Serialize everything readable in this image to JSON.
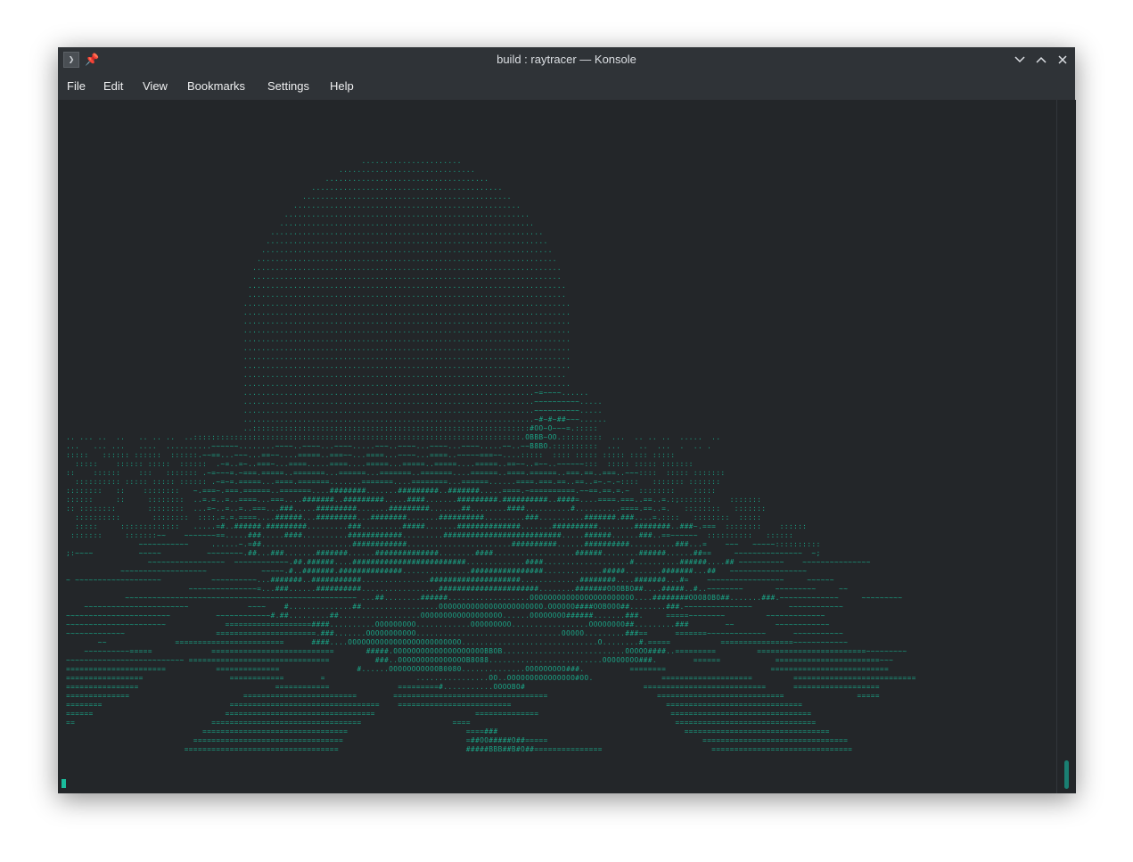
{
  "window": {
    "title": "build : raytracer — Konsole",
    "app_icon": "terminal-icon",
    "app_icon_glyph": "❯",
    "pin_icon": "pin-icon",
    "pin_glyph": "📌",
    "controls": [
      "minimize-icon",
      "maximize-icon",
      "close-icon"
    ]
  },
  "menu": {
    "file": "File",
    "edit": "Edit",
    "view": "View",
    "bookmarks": "Bookmarks",
    "settings": "Settings",
    "help": "Help"
  },
  "terminal": {
    "colors": {
      "background": "#232629",
      "foreground": "#1aa486",
      "cursor": "#1abc9c"
    },
    "ascii_art": [
      "                                                                  ......................",
      "                                                             ..............................",
      "                                                          ....................................",
      "                                                       ..........................................",
      "                                                     ..............................................",
      "                                                   ..................................................",
      "                                                 ......................................................",
      "                                                ........................................................",
      "                                              ............................................................",
      "                                             ..............................................................",
      "                                            ................................................................",
      "                                           ..................................................................",
      "                                          ....................................................................",
      "                                          ....................................................................",
      "                                         ......................................................................",
      "                                         ......................................................................",
      "                                        ........................................................................",
      "                                        ........................................................................",
      "                                        ........................................................................",
      "                                        ........................................................................",
      "                                        ........................................................................",
      "                                        ........................................................................",
      "                                        ........................................................................",
      "                                        ........................................................................",
      "                                        .......................................................................",
      "                                        ........................................................................",
      "                                        ................................................................~=~~~~......",
      "                                        ................................................................~~~~~~~~~~.....",
      "                                        ................................................................~~~~~~~~~~.....",
      "                                        ................................................................~#~#~##~~~......",
      "                                        ..:::::::::::::::::::::::::::::::::::::::::::::::::::::::::::::#OO~O~~~=.:::::",
      " .. ... ..  ..   .. .. ..  ..::::::::::::::::::::::::::::::::::::::::::::::::::::::::::::::::::::::::.OBBB~OO.:::::::::  ...  .. .. ..  .....  ..",
      " ...   ... ...   ....  ..........~~~~~~........~~~~..~~~~...~~~~.....~~~..~~~~...~~~~...~~~~.....~~..~~B8BO.::::::::::  ...    ..  ...  .  .. .",
      " :::::   :::::: ::::::  ::::::.~~==...~~~...==~~....=====..===~~...====...~~~~...====..~~~~~===~~....:::::  :::: ::::: ::::: :::: :::::",
      "   :::::    :::::: :::::  ::::::  .~=..=~..===~...====.....====....=====...=====..=====....=====..==~~..=~~..~~~~~~:::  ::::: ::::: :::::::",
      " ::    ::::::    :::   ::::::: .~=~~~=.~===.=====..=======...======...=======..=======....======..====.======..===.==..===..~~~::::  ::::: :::::::",
      "   :::::::::: ::::: ::::: :::::: .~=~=.=====...====.=======.......=======....========...======......====.===.==..==..=~.~.~::::   ::::::: :::::::",
      " ::::::::   ::    ::::::::   ~.===~.===.======..=======....########.......#########..#######.....====.~==========.~~==.==.=.~  ::::::::    :::::",
      " ::::::     ::     ::::::::  ..=.=..=..====...===....#######..#########.....####.......#########.##########..####=....====.===..==..=.:;:::::::    :::::::",
      " :: ::::::::       ::::::::  ...=~..=..=..===...###.....#########.......#########.......##........####..........#..........====.==..=.   ::::::::   :::::::",
      "   ::::::::::       ::::::::  ::::.=.=.====....######...#########...########.......##########.........###..........#######.###....=.::::   ::::::::  :::::",
      "   :::::     :::::::::::::   .....=#..######.#########.........###.........#####.......##############.......##########........########..###~.===  ::::::::    ::::::",
      "  :::::::     :::::::~~    ~~~~~~~==.....###.....####..........############.........##########################.....######......###..==~~~~~~  ::::::::::   ::::::",
      "                 ~~~~~~~~~~~     ......~.=##....................############.......................##########......##########..........###...=    ~~~   ~~~~~::::::::::",
      " ;:~~~~          ~~~~~          ~~~~~~~~.##...###.......#######......##############........####..................######........######......##==     ~~~~~~~~~~~~~~~  ~;",
      "                   ~~~~~~~~~~~~~~~~~  ~~~~~~~~~~~~.##.######....#########################.............####...................#..........######....## ~~~~~~~~~~    ~~~~~~~~~~~~~~~",
      "             ~~~~~~~~~~~~~~~~~~~            ~~~~~.#..#######.##############...............################.............#####........#######...##   ~~~~~~~~~~~~~~~~~",
      " ~ ~~~~~~~~~~~~~~~~~~~           ~~~~~~~~~~...#######..###########...............####################.............########....#######...#=    ~~~~~~~~~~~~~~~~~     ~~~~~~",
      "                            ~~~~~~~~~~~~~~~=...###......##########.................######################........#######OOOBBO##....#####..#..~~~~~~~~       ~~~~~~~~~     ~~",
      "              ~~~~~~~~~~~~~~~~~~~~~~~~~~~~~~~~~~~~~~~~~~~~~~~~~~~ ...##........######..................OOOOOOOOOOOOOOOOOOOOOOO....########OOO8OBO##.......###.~~~~~~~~~~~~~     ~~~~~~~~~",
      "     ~~~~~~~~~~~~~~~~~~~~~~~             ~~~~    #..............##.................OOOOOOOOOOOOOOOOOOOOOOO.OOOOOO####OOBOOO##........###.~~~~~~~~~~~~~~~        ~~~~~~~~~~~~",
      " ~~~~~~~~~~~~~~~~~~~~~~~          ~~~~~~~~~~~~#.##.........##..................OOOOOOOOOOOOOOOOOO......OOOOOOOO######.......###.     =====~~~~~~~~         ~~~~~~~~~~~~~",
      " ~~~~~~~~~~~~~~~~~~~~~~             ===================####..........OOOOOOOOO............OOOOOOOOO.................OOOOOOOO##.........###        ~~         ~~~~~~~~~~~~",
      " ~~~~~~~~~~~~~                    ======================.###.......OOOOOOOOOOO................................OOOOO.........###==      =======~~~~~~~~~~~~~      ~~~~~~~~~~~",
      "        ~~               ========================      ####....OOOOOOOOOOOOOOOOOOOOOOOOO..............................O........#.=====           ================~~~~~~~~~~~~",
      "     ~~~~~~~~~~=====             ===========================       #####.OOOOOOOOOOOOOOOOOOOOBBOB...........................OOOOO####..=========         ========================~~~~~~~~~",
      " ~~~~~~~~~~~~~~~~~~~~~~~~~~ ===============================          ###..OOOOOOOOOOOOOOOB8O88.........................OOOOOOOO###.        ======            =======================~~~",
      " ======================           ==============                 #......OOOOOOOOOOOB0080..............OOOOOOOOO###.          ========                       ==========================",
      " =================                   ============        =                    ................OO..OOOOOOOOOOOOOOO#OO.               ====================         ===========================",
      " ================                              ============               =========#...........OOOOBO#                          ===========================      ===================",
      " ==============                         =========================        ==================================                        ============================                =====",
      " ========                            =================================    =========================                                  ==============================",
      " ======                             =================================                      ==============                             ===============================",
      " ==                              =================================                    ====                                             ===============================",
      "                               ================================                          ====###                                         ================================",
      "                             =================================                           =##OO#####O##=====                                  ================================",
      "                           ==================================                            #####BBB##B#O##===============                        ==============================="
    ]
  }
}
